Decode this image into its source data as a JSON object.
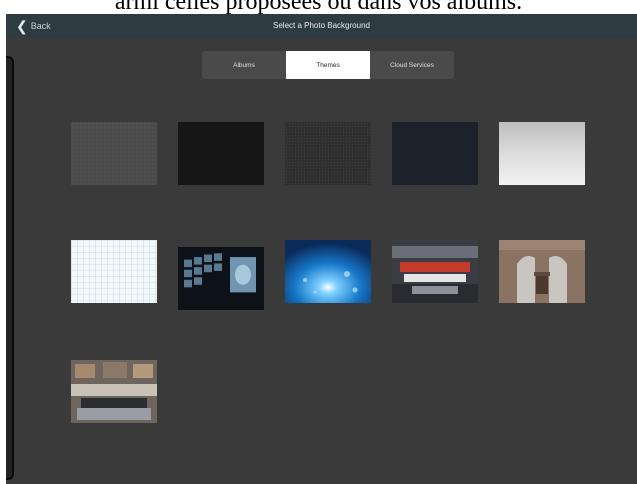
{
  "caption": "armi celles proposées ou dans vos albums.",
  "navbar": {
    "back_label": "Back",
    "title": "Select a Photo Background"
  },
  "segments": [
    {
      "label": "Albums",
      "active": false
    },
    {
      "label": "Themes",
      "active": true
    },
    {
      "label": "Cloud Services",
      "active": false
    }
  ],
  "icons": {
    "back": "chevron-left-icon"
  },
  "thumbnails": [
    {
      "name": "dark-gray-dots"
    },
    {
      "name": "black-texture"
    },
    {
      "name": "dark-dotted-pattern"
    },
    {
      "name": "dark-navy-texture"
    },
    {
      "name": "light-gray-gradient"
    },
    {
      "name": "blue-grid-paper"
    },
    {
      "name": "video-wall-studio"
    },
    {
      "name": "blue-light-burst"
    },
    {
      "name": "news-studio"
    },
    {
      "name": "lincoln-memorial-podium"
    },
    {
      "name": "news-desk-studio"
    }
  ],
  "colors": {
    "navbar": "#2f3b42",
    "background": "#3a3a3a",
    "segment_active": "#ffffff"
  }
}
